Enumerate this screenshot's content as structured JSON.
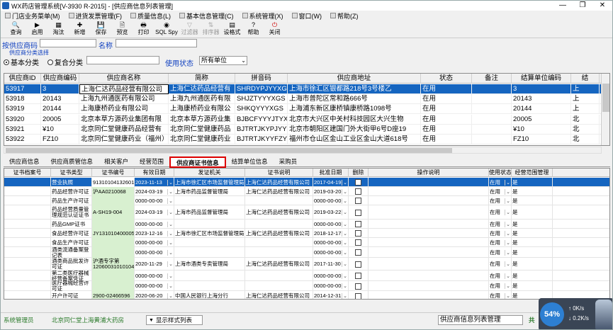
{
  "window": {
    "title": "WX药店管理系统[V-3930 R-2015] - [供应商信息列表管理]"
  },
  "window_buttons": {
    "min": "—",
    "max": "❐",
    "close": "✕"
  },
  "menu": [
    "门店业务菜单(M)",
    "进货发票管理(F)",
    "质量信息(L)",
    "基本信息管理(C)",
    "系统管理(X)",
    "窗口(W)",
    "帮助(Z)"
  ],
  "toolbar": [
    {
      "label": "查询",
      "icon": "🔍",
      "enabled": true
    },
    {
      "label": "启用",
      "icon": "▶",
      "enabled": true
    },
    {
      "label": "淘汰",
      "icon": "▦",
      "enabled": true
    },
    {
      "label": "新增",
      "icon": "✚",
      "enabled": true
    },
    {
      "label": "保存",
      "icon": "💾",
      "enabled": true
    },
    {
      "label": "预览",
      "icon": "🗎",
      "enabled": true
    },
    {
      "label": "打印",
      "icon": "🖶",
      "enabled": true
    },
    {
      "label": "SQL Spy",
      "icon": "◉",
      "enabled": true
    },
    {
      "label": "过滤器",
      "icon": "▽",
      "enabled": false
    },
    {
      "label": "排序器",
      "icon": "⇅",
      "enabled": false
    },
    {
      "label": "设格式",
      "icon": "▤",
      "enabled": true
    },
    {
      "label": "帮助",
      "icon": "?",
      "enabled": true
    },
    {
      "label": "关闭",
      "icon": "⏻",
      "enabled": true
    }
  ],
  "search": {
    "code_label": "按供应商码",
    "code_value": "",
    "name_label": "名称",
    "name_value": "",
    "group_label": "供应商分类选择",
    "opt_basic": "基本分类",
    "opt_combo": "复合分类",
    "combo_value": "",
    "status_label": "使用状态",
    "status_value": "所有单位"
  },
  "grid1": {
    "headers": [
      "供应商ID",
      "供应商编码",
      "供应商名称",
      "简称",
      "拼音码",
      "供应商地址",
      "状态",
      "备注",
      "结算单位编码",
      "结"
    ],
    "rows": [
      [
        "53917",
        "3",
        "上海仁达药品经营有限公司",
        "上海仁达药品经营有",
        "SHRDYPJYYXGS",
        "上海市徐汇区银都路218号3号楼乙",
        "在用",
        "",
        "3",
        "上"
      ],
      [
        "53918",
        "20143",
        "上海九州通医药有限公司",
        "上海九州通医药有限",
        "SHJZTYYYXGS",
        "上海市普陀区常和路666号",
        "在用",
        "",
        "20143",
        "上"
      ],
      [
        "53919",
        "20144",
        "上海康桥药业有限公司",
        "上海康桥药业有限公",
        "SHKQYYYXGS",
        "上海浦东新区康桥镇康桥路1098号",
        "在用",
        "",
        "20144",
        "上"
      ],
      [
        "53920",
        "20005",
        "北京本草方源药业集团有限",
        "北京本草方源药业集",
        "BJBCFYYYJTYXGS",
        "北京市大兴区中关村科技园区大兴生物",
        "在用",
        "",
        "20005",
        "北"
      ],
      [
        "53921",
        "¥10",
        "北京同仁堂健康药品经营有",
        "北京同仁堂健康药品",
        "BJTRTJKYPJYYXGS",
        "北京市朝阳区建国门外大街甲6号D座19",
        "在用",
        "",
        "¥10",
        "北"
      ],
      [
        "53922",
        "FZ10",
        "北京同仁堂健康药业（福州）",
        "北京同仁堂健康药业",
        "BJTRTJKYYFZYXGS",
        "福州市仓山区金山工业区金山大道618号",
        "在用",
        "",
        "FZ10",
        "北"
      ]
    ]
  },
  "tabs": [
    "供应商信息",
    "供应商质管信息",
    "相关客户",
    "经营范围",
    "供应商证书信息",
    "结算单位信息",
    "采购员"
  ],
  "active_tab": 4,
  "grid2": {
    "headers": [
      "证书档案号",
      "证书类型",
      "证书编号",
      "有效日期",
      "发证机关",
      "证书说明",
      "批准日期",
      "删除",
      "操作说明",
      "使用状态",
      "经营范围管理"
    ],
    "rows": [
      [
        "",
        "营业执照",
        "91310104132601Z",
        "2023-11-13",
        "上海市徐汇区市场监督管理局",
        "上海仁达药品经营有限公司",
        "2017-04-19",
        "",
        "",
        "在用",
        "是"
      ],
      [
        "",
        "药品经营许可证",
        "沪AA0210068",
        "2024-03-19",
        "上海市药品监督管理局",
        "上海仁达药品经营有限公司",
        "2019-03-20",
        "",
        "",
        "在用",
        "是"
      ],
      [
        "",
        "药品生产许可证",
        "",
        "0000-00-00",
        "",
        "",
        "0000-00-00",
        "",
        "",
        "在用",
        "是"
      ],
      [
        "",
        "药品经营质量管理规范认证证书",
        "A-SH19-004",
        "2024-03-19",
        "上海市药品监督管理局",
        "上海仁达药品经营有限公司",
        "2019-03-22",
        "",
        "",
        "在用",
        "是"
      ],
      [
        "",
        "药品GMP证书",
        "",
        "0000-00-00",
        "",
        "",
        "0000-00-00",
        "",
        "",
        "在用",
        "是"
      ],
      [
        "",
        "食品经营许可证",
        "JY1310104000055",
        "2023-12-16",
        "上海市徐汇区市场监督管理局",
        "上海仁达药品经营有限公司",
        "2018-12-17",
        "",
        "",
        "在用",
        "是"
      ],
      [
        "",
        "食品生产许可证",
        "",
        "0000-00-00",
        "",
        "",
        "0000-00-00",
        "",
        "",
        "在用",
        "是"
      ],
      [
        "",
        "酒类流通备案登记表",
        "",
        "0000-00-00",
        "",
        "",
        "0000-00-00",
        "",
        "",
        "在用",
        "是"
      ],
      [
        "",
        "酒类商品批发许可证",
        "沪酒专字第120600310101042",
        "2020-11-29",
        "上海市酒类专卖管理局",
        "上海仁达药品经营有限公司",
        "2017-11-30",
        "",
        "",
        "在用",
        "是"
      ],
      [
        "",
        "第二类医疗器械经营备案凭证",
        "",
        "0000-00-00",
        "",
        "",
        "0000-00-00",
        "",
        "",
        "在用",
        "是"
      ],
      [
        "",
        "医疗器械经营许可证",
        "",
        "0000-00-00",
        "",
        "",
        "0000-00-00",
        "",
        "",
        "在用",
        "是"
      ],
      [
        "",
        "开户许可证",
        "2900-02466596",
        "2020-06-20",
        "中国人民银行上海分行",
        "上海仁达药品经营有限公司",
        "2014-12-31",
        "",
        "",
        "在用",
        "是"
      ]
    ]
  },
  "status": {
    "user": "系统管理员",
    "store": "北京同仁堂上海黄浦大药房",
    "style_label": "显示样式列表",
    "form_name": "供应商信息列表管理",
    "right": "共"
  },
  "overlay": {
    "percent": "54%",
    "up": "0K/s",
    "down": "0.2K/s"
  }
}
